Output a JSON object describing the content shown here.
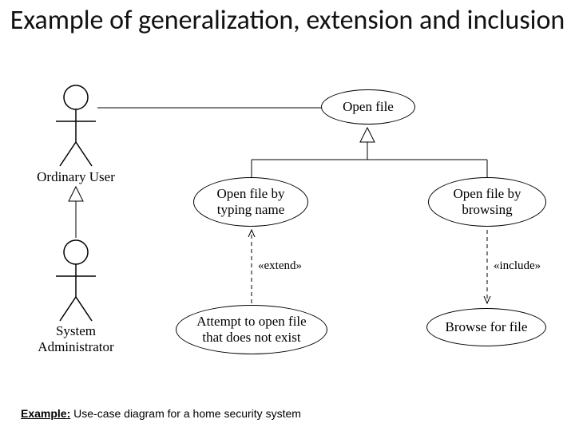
{
  "title": "Example of generalization, extension and inclusion",
  "actors": {
    "ordinary_user": "Ordinary User",
    "system_admin_l1": "System",
    "system_admin_l2": "Administrator"
  },
  "usecases": {
    "open_file": "Open file",
    "open_by_typing_l1": "Open file by",
    "open_by_typing_l2": "typing name",
    "open_by_browsing_l1": "Open file by",
    "open_by_browsing_l2": "browsing",
    "attempt_l1": "Attempt to open file",
    "attempt_l2": "that does not exist",
    "browse": "Browse for file"
  },
  "stereotypes": {
    "extend": "«extend»",
    "include": "«include»"
  },
  "footer": {
    "label": "Example:",
    "text": " Use-case diagram for a home security system"
  }
}
